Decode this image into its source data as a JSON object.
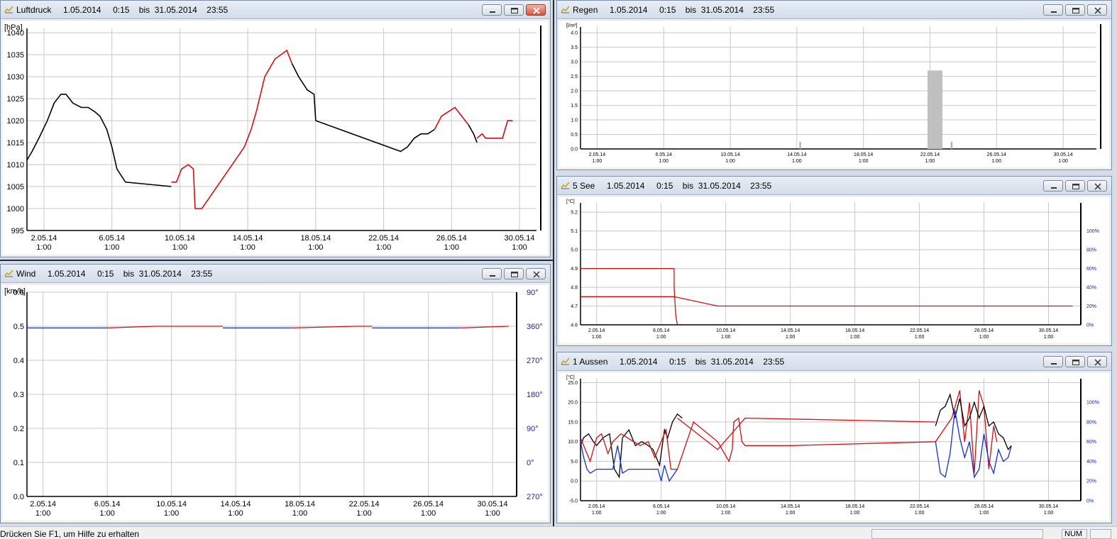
{
  "status": {
    "text": "Drücken Sie F1, um Hilfe zu erhalten",
    "num": "NUM"
  },
  "window_buttons": {
    "minimize": "minimize",
    "maximize": "maximize",
    "close": "close"
  },
  "windows": {
    "luftdruck": {
      "title": "Luftdruck     1.05.2014     0:15    bis  31.05.2014    23:55",
      "unit": "[hPa]",
      "xticks": [
        "2.05.14",
        "6.05.14",
        "10.05.14",
        "14.05.14",
        "18.05.14",
        "22.05.14",
        "26.05.14",
        "30.05.14"
      ],
      "xtime": "1:00",
      "yticks": [
        "995",
        "1000",
        "1005",
        "1010",
        "1015",
        "1020",
        "1025",
        "1030",
        "1035",
        "1040"
      ]
    },
    "wind": {
      "title": "Wind     1.05.2014     0:15    bis  31.05.2014    23:55",
      "unit": "[km/h]",
      "xticks": [
        "2.05.14",
        "6.05.14",
        "10.05.14",
        "14.05.14",
        "18.05.14",
        "22.05.14",
        "26.05.14",
        "30.05.14"
      ],
      "xtime": "1:00",
      "yticks": [
        "0.0",
        "0.1",
        "0.2",
        "0.3",
        "0.4",
        "0.5",
        "0.6"
      ],
      "rticks": [
        "270°",
        "0°",
        "90°",
        "180°",
        "270°",
        "360°",
        "90°"
      ]
    },
    "regen": {
      "title": "Regen     1.05.2014     0:15    bis  31.05.2014    23:55",
      "unit": "[l/m²]",
      "xticks": [
        "2.05.14",
        "6.05.14",
        "10.05.14",
        "14.05.14",
        "18.05.14",
        "22.05.14",
        "26.05.14",
        "30.05.14"
      ],
      "xtime": "1:00",
      "yticks": [
        "0.0",
        "0.5",
        "1.0",
        "1.5",
        "2.0",
        "2.5",
        "3.0",
        "3.5",
        "4.0"
      ]
    },
    "see": {
      "title": "5 See     1.05.2014     0:15    bis  31.05.2014    23:55",
      "unit": "[°C]",
      "xticks": [
        "2.05.14",
        "6.05.14",
        "10.05.14",
        "14.05.14",
        "18.05.14",
        "22.05.14",
        "26.05.14",
        "30.05.14"
      ],
      "xtime": "1:00",
      "yticks": [
        "4.6",
        "4.7",
        "4.8",
        "4.9",
        "5.0",
        "5.1",
        "5.2"
      ],
      "rticks": [
        "0%",
        "20%",
        "40%",
        "60%",
        "80%",
        "100%"
      ]
    },
    "aussen": {
      "title": "1 Aussen     1.05.2014     0:15    bis  31.05.2014    23:55",
      "unit": "[°C]",
      "xticks": [
        "2.05.14",
        "6.05.14",
        "10.05.14",
        "14.05.14",
        "18.05.14",
        "22.05.14",
        "26.05.14",
        "30.05.14"
      ],
      "xtime": "1:00",
      "yticks": [
        "-5.0",
        "0.0",
        "5.0",
        "10.0",
        "15.0",
        "20.0",
        "25.0"
      ],
      "rticks": [
        "0%",
        "20%",
        "40%",
        "60%",
        "80%",
        "100%"
      ]
    }
  },
  "chart_data": [
    {
      "type": "line",
      "xlim": [
        1.0,
        31.0
      ],
      "ylim": [
        995,
        1041
      ],
      "series": [
        {
          "color": "#000000",
          "x": [
            1.0,
            1.3,
            1.7,
            2.2,
            2.6,
            3.0,
            3.3,
            3.7,
            4.2,
            4.6,
            5.0,
            5.3,
            5.7,
            6.0,
            6.3,
            6.8,
            9.5
          ],
          "y": [
            1011,
            1013,
            1016,
            1020,
            1024,
            1026,
            1026,
            1024,
            1023,
            1023,
            1022,
            1021,
            1018,
            1014,
            1009,
            1006,
            1005
          ]
        },
        {
          "color": "#d01010",
          "x": [
            9.5,
            9.8,
            10.1,
            10.5,
            10.8,
            10.9,
            11.3,
            13.8,
            14.2,
            14.5,
            15.0,
            15.6,
            16.3,
            16.6
          ],
          "y": [
            1006,
            1006,
            1009,
            1010,
            1009,
            1000,
            1000,
            1014,
            1018,
            1022,
            1030,
            1034,
            1036,
            1033
          ]
        },
        {
          "color": "#000000",
          "x": [
            16.6,
            17.0,
            17.5,
            17.9,
            18.0,
            23.0,
            23.4,
            23.8,
            24.2,
            24.6,
            25.0
          ],
          "y": [
            1033,
            1030,
            1027,
            1026,
            1020,
            1013,
            1014,
            1016,
            1017,
            1017,
            1018
          ]
        },
        {
          "color": "#d01010",
          "x": [
            25.0,
            25.4,
            25.8,
            26.2,
            26.6,
            27.0
          ],
          "y": [
            1018,
            1021,
            1022,
            1023,
            1021,
            1019
          ]
        },
        {
          "color": "#000000",
          "x": [
            27.0,
            27.3,
            27.5
          ],
          "y": [
            1019,
            1017,
            1015
          ]
        },
        {
          "color": "#d01010",
          "x": [
            27.5,
            27.8,
            28.0,
            29.0,
            29.3,
            29.6
          ],
          "y": [
            1016,
            1017,
            1016,
            1016,
            1020,
            1020
          ]
        }
      ]
    },
    {
      "type": "line",
      "xlim": [
        1.0,
        31.5
      ],
      "ylim": [
        0.0,
        0.6
      ],
      "series": [
        {
          "color": "#1030d0",
          "x": [
            1.0,
            6.0
          ],
          "y": [
            0.495,
            0.495
          ]
        },
        {
          "color": "#d01010",
          "x": [
            6.0,
            9.0,
            13.2
          ],
          "y": [
            0.495,
            0.5,
            0.5
          ]
        },
        {
          "color": "#1030d0",
          "x": [
            13.2,
            17.5
          ],
          "y": [
            0.495,
            0.495
          ]
        },
        {
          "color": "#d01010",
          "x": [
            17.5,
            21.5,
            22.5
          ],
          "y": [
            0.495,
            0.5,
            0.5
          ]
        },
        {
          "color": "#1030d0",
          "x": [
            22.5,
            28.0
          ],
          "y": [
            0.495,
            0.495
          ]
        },
        {
          "color": "#d01010",
          "x": [
            28.0,
            31.0
          ],
          "y": [
            0.495,
            0.5
          ]
        }
      ]
    },
    {
      "type": "bar",
      "xlim": [
        1.0,
        32.0
      ],
      "ylim": [
        0.0,
        4.2
      ],
      "bars": [
        {
          "x": 14.2,
          "value": 0.25,
          "width": 0.1
        },
        {
          "x": 22.3,
          "value": 2.7,
          "width": 0.9
        },
        {
          "x": 23.3,
          "value": 0.25,
          "width": 0.1
        }
      ]
    },
    {
      "type": "line",
      "xlim": [
        1.0,
        32.0
      ],
      "ylim": [
        4.6,
        5.25
      ],
      "series": [
        {
          "color": "#d01010",
          "x": [
            1.0,
            6.8,
            6.8,
            6.9,
            7.0
          ],
          "y": [
            4.9,
            4.9,
            4.8,
            4.65,
            4.6
          ]
        },
        {
          "color": "#d01010",
          "x": [
            1.0,
            6.8,
            9.5,
            31.5
          ],
          "y": [
            4.75,
            4.75,
            4.7,
            4.7
          ]
        }
      ]
    },
    {
      "type": "line",
      "xlim": [
        1.0,
        32.0
      ],
      "ylim": [
        -5.0,
        26.0
      ],
      "series": [
        {
          "color": "#000000",
          "x": [
            1.0,
            1.2,
            1.5,
            1.8,
            2.0,
            2.4,
            2.8,
            3.1,
            3.4,
            3.6,
            4.0,
            4.4,
            4.8,
            5.2,
            5.5,
            5.9,
            6.2,
            6.4,
            6.7,
            7.0,
            7.3
          ],
          "y": [
            9,
            11,
            12,
            10,
            9,
            11,
            12,
            3,
            1,
            11,
            13,
            9,
            10,
            9,
            8,
            4,
            13,
            11,
            15,
            17,
            16
          ]
        },
        {
          "color": "#d01010",
          "x": [
            1.0,
            1.3,
            1.6,
            2.0,
            2.3,
            2.7,
            3.0,
            3.5,
            3.9,
            4.3,
            4.7,
            5.2,
            5.6,
            6.0,
            6.3,
            6.6,
            7.0,
            8.0,
            9.5,
            10.2,
            10.4,
            10.5,
            10.8,
            11.0,
            11.2,
            14.0,
            23.0,
            24.0,
            24.5,
            24.8,
            25.1,
            25.4,
            25.7,
            26.0,
            26.3,
            26.6,
            26.8
          ],
          "y": [
            11,
            8,
            5,
            11,
            12,
            7,
            10,
            12,
            11,
            10,
            9,
            10,
            6,
            10,
            13,
            3,
            3,
            15,
            10,
            5,
            8,
            15,
            16,
            10,
            9,
            9,
            10,
            16,
            23,
            10,
            20,
            2,
            23,
            19,
            3,
            14,
            10
          ]
        },
        {
          "color": "#d01010",
          "x": [
            7.0,
            9.5,
            11.2,
            23.0
          ],
          "y": [
            16,
            8,
            16,
            15
          ]
        },
        {
          "color": "#1030d0",
          "x": [
            1.0,
            1.2,
            1.4,
            1.6,
            2.0,
            2.4,
            3.0,
            3.3,
            3.6,
            4.0,
            4.6,
            5.2,
            5.8,
            6.0,
            6.2,
            6.5,
            7.0
          ],
          "y": [
            10,
            6,
            3,
            2,
            3,
            3,
            3,
            9,
            2,
            3,
            3,
            3,
            3,
            0,
            4,
            0,
            3
          ]
        },
        {
          "color": "#000000",
          "x": [
            23.0,
            23.3,
            23.6,
            23.9,
            24.2,
            24.5,
            24.8,
            25.1,
            25.4,
            25.7,
            26.0,
            26.3,
            26.6,
            26.9,
            27.2,
            27.5,
            27.7
          ],
          "y": [
            14,
            18,
            19,
            22,
            16,
            21,
            14,
            16,
            20,
            16,
            19,
            14,
            15,
            12,
            11,
            8,
            9
          ]
        },
        {
          "color": "#1030d0",
          "x": [
            23.0,
            23.3,
            23.6,
            23.9,
            24.2,
            24.5,
            24.8,
            25.1,
            25.4,
            25.7,
            26.0,
            26.3,
            26.6,
            26.9,
            27.2,
            27.5,
            27.7
          ],
          "y": [
            10,
            2,
            1,
            7,
            18,
            11,
            6,
            10,
            1,
            3,
            12,
            5,
            2,
            8,
            5,
            6,
            9
          ]
        }
      ]
    }
  ]
}
